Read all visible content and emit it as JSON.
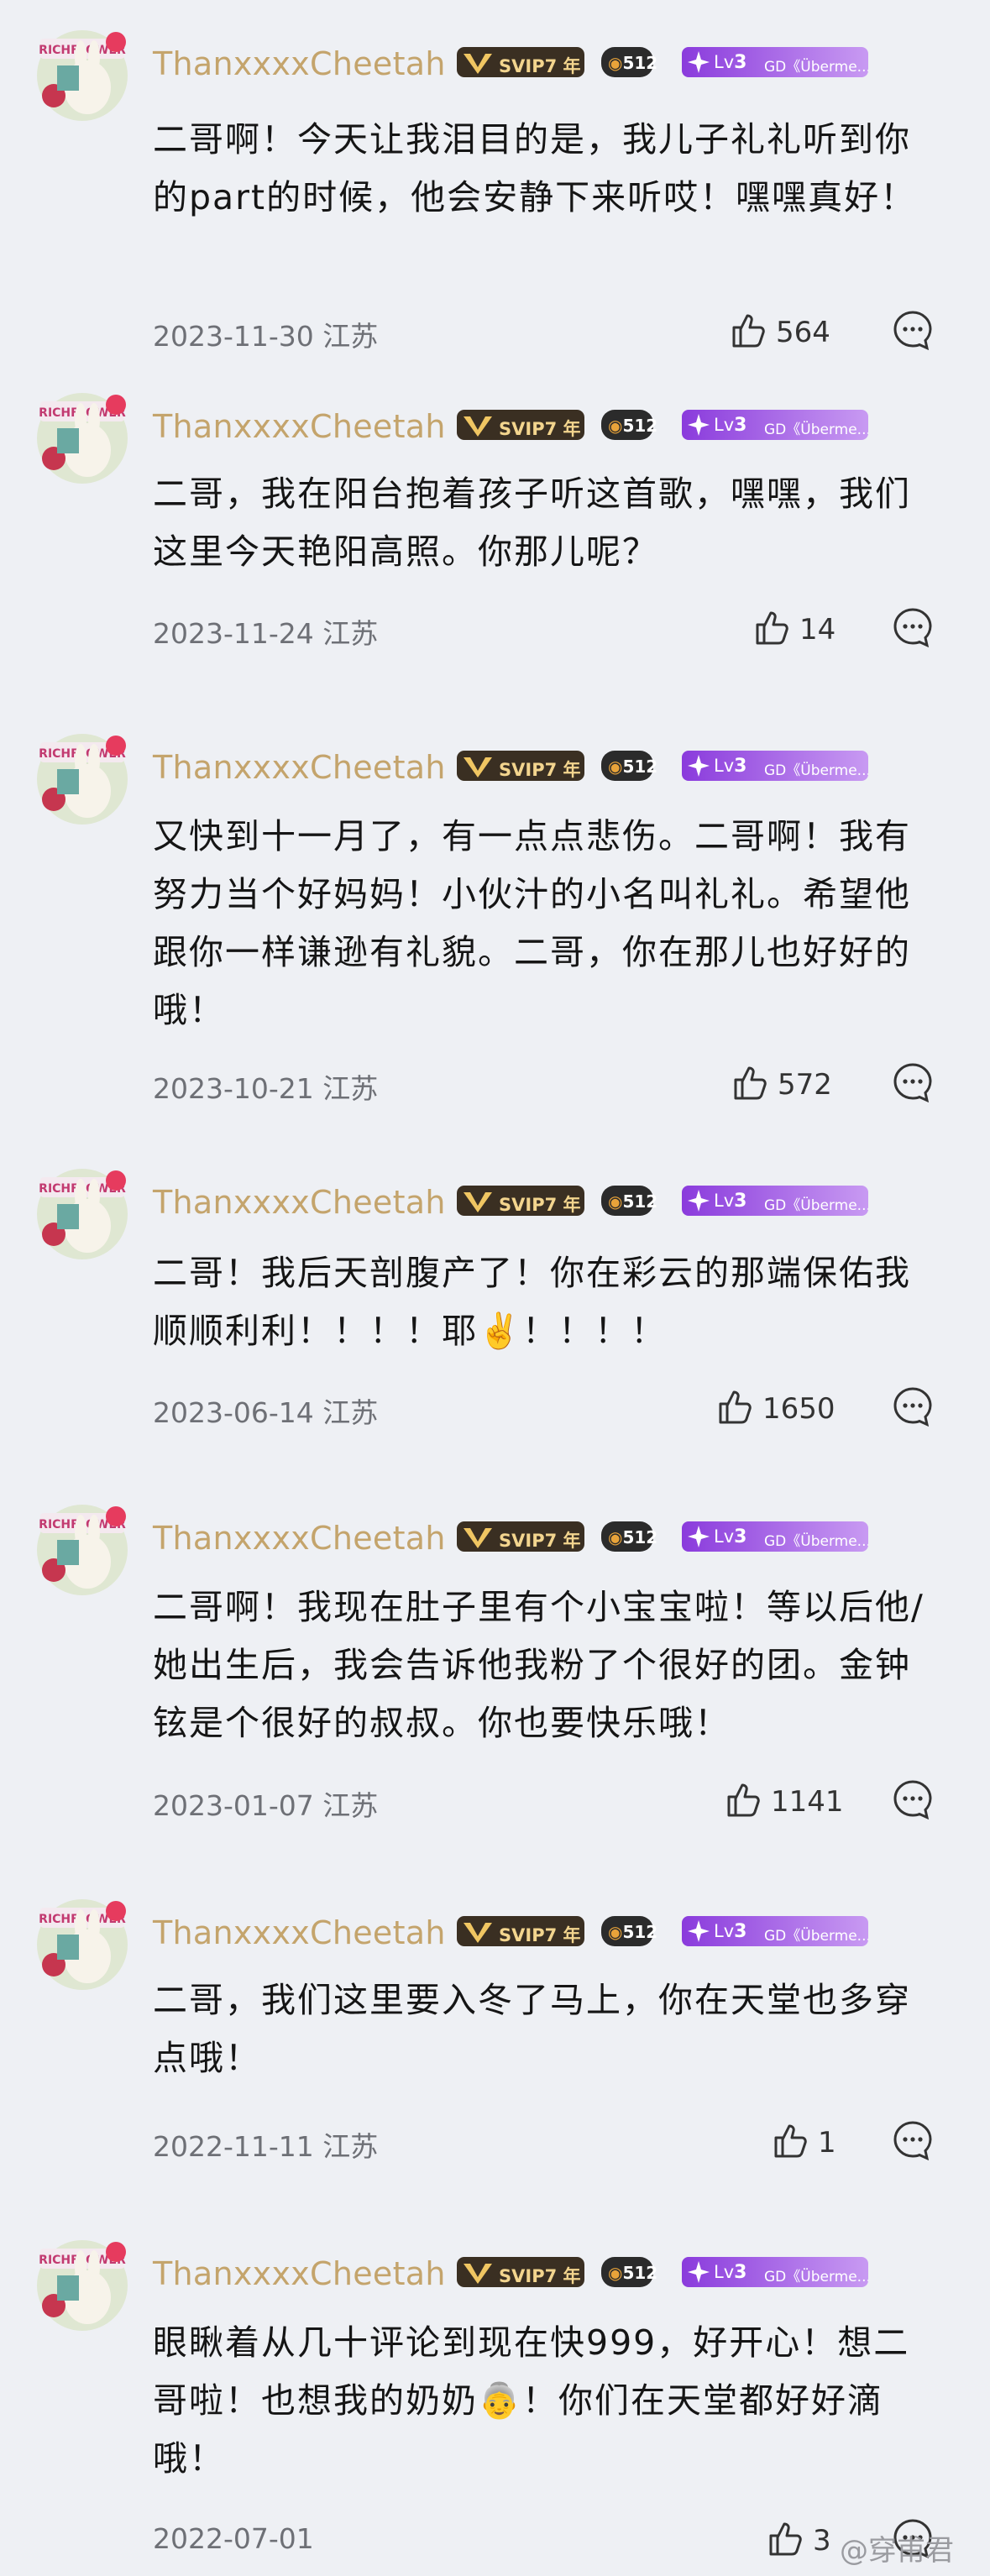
{
  "colors": {
    "background": "#eef0f4",
    "username": "#c4a46c",
    "text": "#151515",
    "meta": "#6e7076"
  },
  "badges": {
    "svip": "SVIP7",
    "svip_suffix": "年",
    "os": "512",
    "lv_prefix": "Lv",
    "lv_num": "3",
    "club": "GD《Überme..."
  },
  "comments": [
    {
      "username": "ThanxxxxCheetah",
      "text": "二哥啊！今天让我泪目的是，我儿子礼礼听到你的part的时候，他会安静下来听哎！嘿嘿真好！",
      "date": "2023-11-30",
      "location": "江苏",
      "likes": "564"
    },
    {
      "username": "ThanxxxxCheetah",
      "text": "二哥，我在阳台抱着孩子听这首歌，嘿嘿，我们这里今天艳阳高照。你那儿呢？",
      "date": "2023-11-24",
      "location": "江苏",
      "likes": "14"
    },
    {
      "username": "ThanxxxxCheetah",
      "text": "又快到十一月了，有一点点悲伤。二哥啊！我有努力当个好妈妈！小伙汁的小名叫礼礼。希望他跟你一样谦逊有礼貌。二哥，你在那儿也好好的哦！",
      "date": "2023-10-21",
      "location": "江苏",
      "likes": "572"
    },
    {
      "username": "ThanxxxxCheetah",
      "text": "二哥！我后天剖腹产了！你在彩云的那端保佑我顺顺利利！！！！耶✌️！！！！",
      "date": "2023-06-14",
      "location": "江苏",
      "likes": "1650"
    },
    {
      "username": "ThanxxxxCheetah",
      "text": "二哥啊！我现在肚子里有个小宝宝啦！等以后他/她出生后，我会告诉他我粉了个很好的团。金钟铉是个很好的叔叔。你也要快乐哦！",
      "date": "2023-01-07",
      "location": "江苏",
      "likes": "1141"
    },
    {
      "username": "ThanxxxxCheetah",
      "text": "二哥，我们这里要入冬了马上，你在天堂也多穿点哦！",
      "date": "2022-11-11",
      "location": "江苏",
      "likes": "1"
    },
    {
      "username": "ThanxxxxCheetah",
      "text": "眼瞅着从几十评论到现在快999，好开心！想二哥啦！也想我的奶奶👵！你们在天堂都好好滴哦！",
      "date": "2022-07-01",
      "location": "",
      "likes": "3"
    }
  ],
  "watermark": "@穿甫君"
}
